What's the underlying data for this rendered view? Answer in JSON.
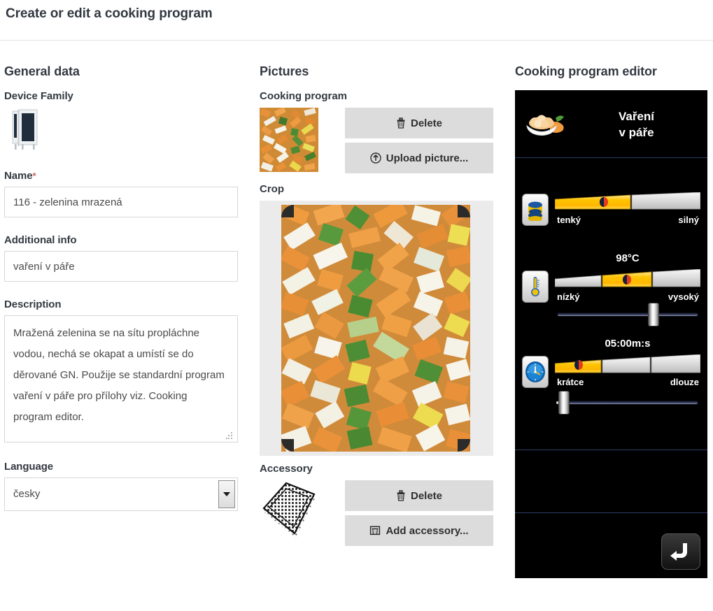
{
  "header": {
    "title": "Create or edit a cooking program"
  },
  "general": {
    "heading": "General data",
    "device_family_label": "Device Family",
    "device_family_icon": "combi-oven-icon",
    "name_label": "Name",
    "name_required_mark": "*",
    "name_value": "116 - zelenina mrazená",
    "additional_info_label": "Additional info",
    "additional_info_value": "vaření v páře",
    "description_label": "Description",
    "description_value": "Mražená zelenina se na sítu propláchne vodou, nechá se okapat a umístí se do děrované GN. Použije se standardní program vaření v páře pro přílohy viz. Cooking program editor.",
    "language_label": "Language",
    "language_value": "česky"
  },
  "pictures": {
    "heading": "Pictures",
    "cooking_program_label": "Cooking program",
    "cooking_program_delete": "Delete",
    "cooking_program_upload": "Upload picture...",
    "crop_label": "Crop",
    "accessory_label": "Accessory",
    "accessory_delete": "Delete",
    "accessory_add": "Add accessory...",
    "icons": {
      "delete": "trash-icon",
      "upload": "upload-circle-icon",
      "add_accessory": "tray-add-icon",
      "move": "move-cursor-icon"
    }
  },
  "editor": {
    "heading": "Cooking program editor",
    "program_title_line1": "Vaření",
    "program_title_line2": "v páře",
    "dish_icon": "bowl-of-food-icon",
    "rows": [
      {
        "id": "humidity",
        "icon": "steam-cylinder-icon",
        "value": "",
        "min_label": "tenký",
        "max_label": "silný",
        "fill_percent": 52,
        "marker_percent": 33,
        "has_slider": false
      },
      {
        "id": "temperature",
        "icon": "thermometer-icon",
        "value": "98°C",
        "min_label": "nízký",
        "max_label": "vysoký",
        "segment_start_percent": 33,
        "segment_end_percent": 67,
        "marker_percent": 50,
        "has_slider": true,
        "slider_percent": 70
      },
      {
        "id": "time",
        "icon": "clock-icon",
        "value": "05:00m:s",
        "min_label": "krátce",
        "max_label": "dlouze",
        "fill_percent": 33,
        "marker_percent": 16,
        "has_slider": true,
        "slider_percent": 3
      }
    ],
    "back_button_icon": "back-arrow-icon"
  },
  "colors": {
    "accent_yellow": "#ffcc00",
    "panel_black": "#000000",
    "divider_blue": "#2b3f63",
    "button_gray": "#dcdcdc",
    "required_red": "#c0655a"
  }
}
